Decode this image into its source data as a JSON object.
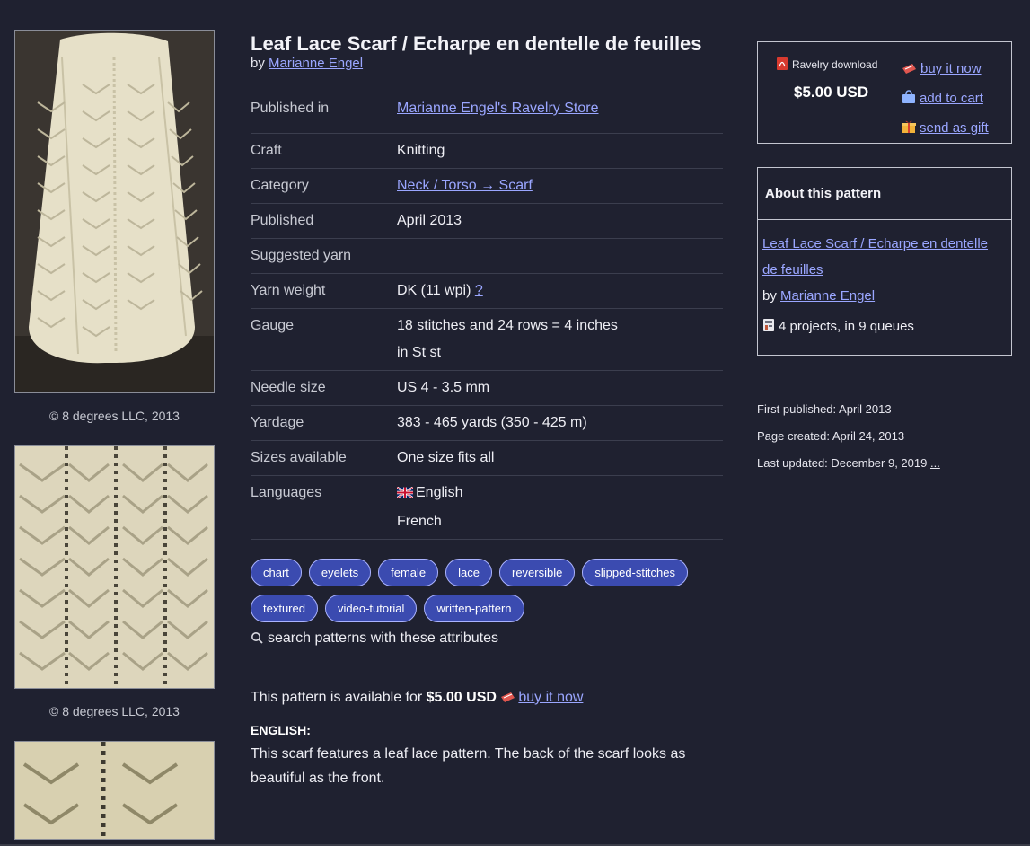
{
  "pattern": {
    "title": "Leaf Lace Scarf / Echarpe en dentelle de feuilles",
    "by_prefix": "by",
    "designer": "Marianne Engel"
  },
  "photos": {
    "captions": [
      "© 8 degrees LLC, 2013",
      "© 8 degrees LLC, 2013"
    ]
  },
  "details": [
    {
      "label": "Published in",
      "value": "Marianne Engel's Ravelry Store",
      "link": true
    },
    {
      "label": "Craft",
      "value": "Knitting"
    },
    {
      "label": "Category",
      "value": "Neck / Torso → Scarf",
      "link": true
    },
    {
      "label": "Published",
      "value": "April 2013"
    },
    {
      "label": "Suggested yarn",
      "value": ""
    },
    {
      "label": "Yarn weight",
      "value": "DK (11 wpi)",
      "extra": "?"
    },
    {
      "label": "Gauge",
      "value": "18 stitches and 24 rows = 4 inches",
      "value2": "in St st"
    },
    {
      "label": "Needle size",
      "value": "US 4 - 3.5 mm"
    },
    {
      "label": "Yardage",
      "value": "383 - 465 yards (350 - 425 m)"
    },
    {
      "label": "Sizes available",
      "value": "One size fits all"
    },
    {
      "label": "Languages",
      "value": "English",
      "value2": "French",
      "flag": "uk-flag-icon"
    }
  ],
  "tags": [
    "chart",
    "eyelets",
    "female",
    "lace",
    "reversible",
    "slipped-stitches",
    "textured",
    "video-tutorial",
    "written-pattern"
  ],
  "search_attributes": "search patterns with these attributes",
  "availability": {
    "prefix": "This pattern is available for",
    "price": "$5.00 USD",
    "buy_label": "buy it now"
  },
  "description": {
    "heading": "ENGLISH:",
    "text": "This scarf features a leaf lace pattern. The back of the scarf looks as beautiful as the front."
  },
  "buybox": {
    "ravelry_download": "Ravelry download",
    "price": "$5.00 USD",
    "buy_now": "buy it now",
    "add_to_cart": "add to cart",
    "send_as_gift": "send as gift"
  },
  "about": {
    "heading": "About this pattern",
    "title_link": "Leaf Lace Scarf / Echarpe en dentelle de feuilles",
    "by_prefix": "by",
    "designer": "Marianne Engel",
    "projects": "4 projects, in 9 queues"
  },
  "meta": {
    "first_published": "First published: April 2013",
    "page_created": "Page created: April 24, 2013",
    "last_updated": "Last updated: December 9, 2019",
    "more": "..."
  },
  "colors": {
    "background": "#1f2130",
    "link": "#9aa6ff",
    "tag_bg": "#3b4bb0",
    "yarn": "#e8e2cc"
  }
}
